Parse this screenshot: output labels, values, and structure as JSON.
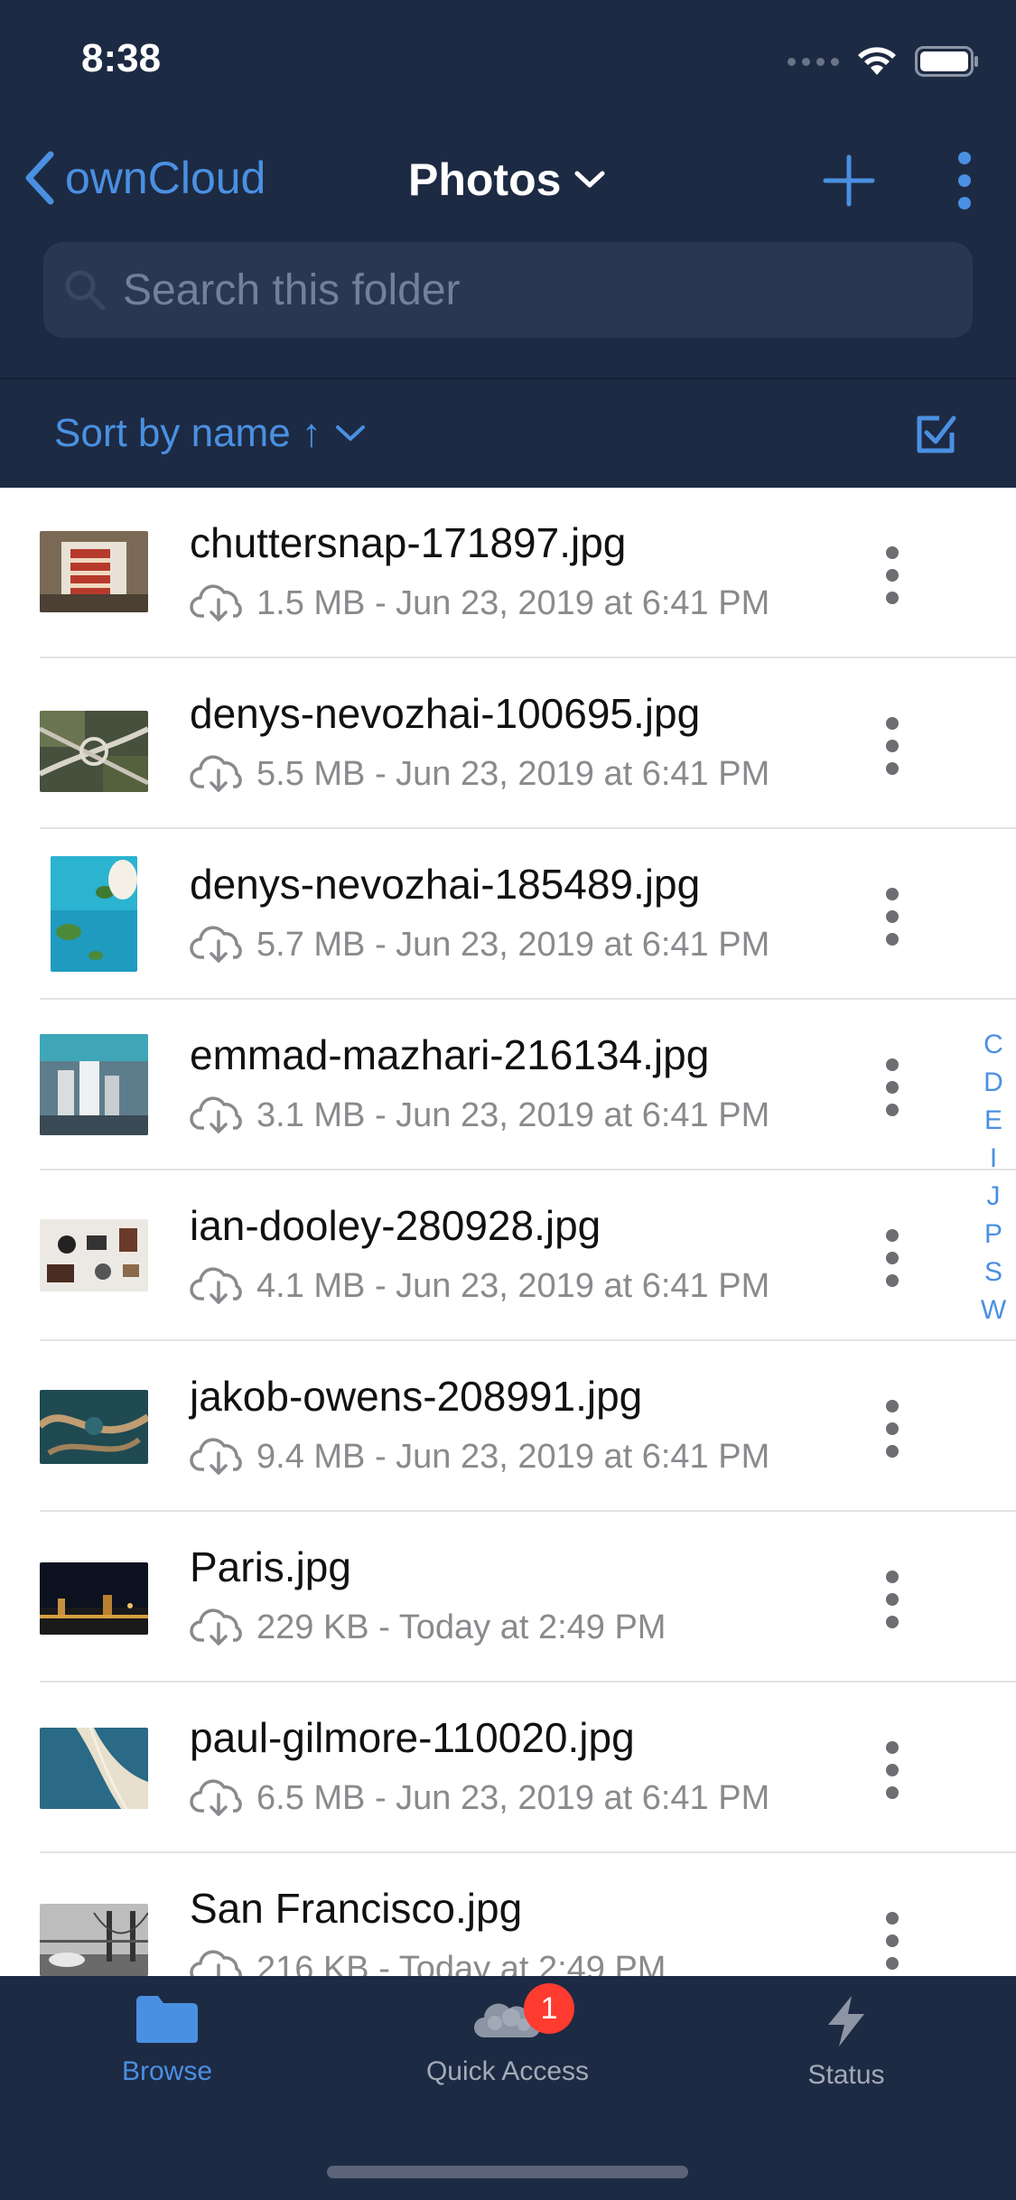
{
  "status_bar": {
    "time": "8:38"
  },
  "nav": {
    "back_label": "ownCloud",
    "title": "Photos",
    "search_placeholder": "Search this folder"
  },
  "sort": {
    "label": "Sort by name ↑"
  },
  "files": [
    {
      "name": "chuttersnap-171897.jpg",
      "meta": "1.5 MB - Jun 23, 2019 at 6:41 PM"
    },
    {
      "name": "denys-nevozhai-100695.jpg",
      "meta": "5.5 MB - Jun 23, 2019 at 6:41 PM"
    },
    {
      "name": "denys-nevozhai-185489.jpg",
      "meta": "5.7 MB - Jun 23, 2019 at 6:41 PM"
    },
    {
      "name": "emmad-mazhari-216134.jpg",
      "meta": "3.1 MB - Jun 23, 2019 at 6:41 PM"
    },
    {
      "name": "ian-dooley-280928.jpg",
      "meta": "4.1 MB - Jun 23, 2019 at 6:41 PM"
    },
    {
      "name": "jakob-owens-208991.jpg",
      "meta": "9.4 MB - Jun 23, 2019 at 6:41 PM"
    },
    {
      "name": "Paris.jpg",
      "meta": "229 KB - Today at 2:49 PM"
    },
    {
      "name": "paul-gilmore-110020.jpg",
      "meta": "6.5 MB - Jun 23, 2019 at 6:41 PM"
    },
    {
      "name": "San Francisco.jpg",
      "meta": "216 KB - Today at 2:49 PM"
    }
  ],
  "index_letters": [
    "C",
    "D",
    "E",
    "I",
    "J",
    "P",
    "S",
    "W"
  ],
  "tabs": {
    "browse": "Browse",
    "quick_access": "Quick Access",
    "quick_access_badge": "1",
    "status": "Status"
  },
  "colors": {
    "header_bg": "#1d2a43",
    "accent": "#4a90e2",
    "badge": "#ff3b30"
  }
}
